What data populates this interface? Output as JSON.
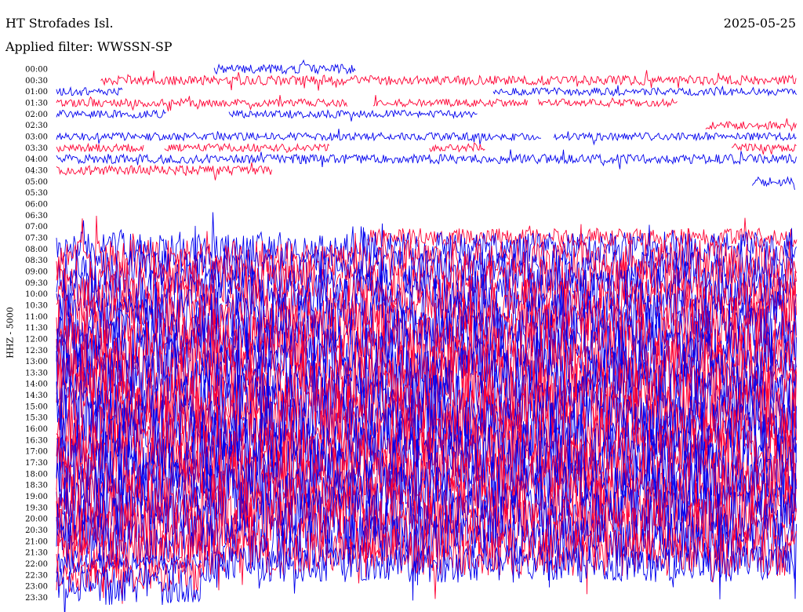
{
  "header": {
    "station": "HT Strofades Isl.",
    "date": "2025-05-25",
    "filter": "Applied filter: WWSSN-SP"
  },
  "chart_data": {
    "type": "line",
    "title": "HT Strofades Isl.",
    "subtitle": "Applied filter: WWSSN-SP",
    "ylabel": "HHZ - 5000",
    "xlabel": "",
    "tick_labels": [
      "00:00",
      "00:30",
      "01:00",
      "01:30",
      "02:00",
      "02:30",
      "03:00",
      "03:30",
      "04:00",
      "04:30",
      "05:00",
      "05:30",
      "06:00",
      "06:30",
      "07:00",
      "07:30",
      "08:00",
      "08:30",
      "09:00",
      "09:30",
      "10:00",
      "10:30",
      "11:00",
      "11:30",
      "12:00",
      "12:30",
      "13:00",
      "13:30",
      "14:00",
      "14:30",
      "15:00",
      "15:30",
      "16:00",
      "16:30",
      "17:00",
      "17:30",
      "18:00",
      "18:30",
      "19:00",
      "19:30",
      "20:00",
      "20:30",
      "21:00",
      "21:30",
      "22:00",
      "22:30",
      "23:00",
      "23:30"
    ],
    "x_minutes_per_line": 30,
    "colors": {
      "odd_lines": "#0000ee",
      "even_lines": "#ff0033"
    },
    "segments": [
      {
        "line": 0,
        "start": 0.213,
        "end": 0.405,
        "amp": 6
      },
      {
        "line": 1,
        "start": 0.06,
        "end": 1.0,
        "amp": 6
      },
      {
        "line": 2,
        "start": 0.0,
        "end": 0.089,
        "amp": 5
      },
      {
        "line": 2,
        "start": 0.59,
        "end": 1.0,
        "amp": 5
      },
      {
        "line": 3,
        "start": 0.0,
        "end": 0.393,
        "amp": 5
      },
      {
        "line": 3,
        "start": 0.428,
        "end": 0.637,
        "amp": 5
      },
      {
        "line": 3,
        "start": 0.651,
        "end": 0.839,
        "amp": 5
      },
      {
        "line": 4,
        "start": 0.0,
        "end": 0.149,
        "amp": 5
      },
      {
        "line": 4,
        "start": 0.233,
        "end": 0.569,
        "amp": 5
      },
      {
        "line": 5,
        "start": 0.877,
        "end": 1.0,
        "amp": 5
      },
      {
        "line": 6,
        "start": 0.0,
        "end": 0.656,
        "amp": 5
      },
      {
        "line": 6,
        "start": 0.672,
        "end": 1.0,
        "amp": 5
      },
      {
        "line": 7,
        "start": 0.0,
        "end": 0.119,
        "amp": 5
      },
      {
        "line": 7,
        "start": 0.146,
        "end": 0.369,
        "amp": 5
      },
      {
        "line": 7,
        "start": 0.504,
        "end": 0.58,
        "amp": 5
      },
      {
        "line": 7,
        "start": 0.912,
        "end": 1.0,
        "amp": 5
      },
      {
        "line": 8,
        "start": 0.0,
        "end": 1.0,
        "amp": 6
      },
      {
        "line": 9,
        "start": 0.0,
        "end": 0.292,
        "amp": 6
      },
      {
        "line": 10,
        "start": 0.94,
        "end": 0.998,
        "amp": 6
      },
      {
        "line": 15,
        "start": 0.42,
        "end": 1.0,
        "amp": 12
      },
      {
        "line": 16,
        "start": 0.0,
        "end": 1.0,
        "amp": 22
      },
      {
        "line": 17,
        "start": 0.0,
        "end": 1.0,
        "amp": 26
      },
      {
        "line": 18,
        "start": 0.0,
        "end": 1.0,
        "amp": 28
      },
      {
        "line": 19,
        "start": 0.0,
        "end": 1.0,
        "amp": 30
      },
      {
        "line": 20,
        "start": 0.0,
        "end": 1.0,
        "amp": 32
      },
      {
        "line": 21,
        "start": 0.0,
        "end": 1.0,
        "amp": 34
      },
      {
        "line": 22,
        "start": 0.0,
        "end": 1.0,
        "amp": 36
      },
      {
        "line": 23,
        "start": 0.0,
        "end": 1.0,
        "amp": 38
      },
      {
        "line": 24,
        "start": 0.0,
        "end": 1.0,
        "amp": 40
      },
      {
        "line": 25,
        "start": 0.0,
        "end": 1.0,
        "amp": 42
      },
      {
        "line": 26,
        "start": 0.0,
        "end": 1.0,
        "amp": 42
      },
      {
        "line": 27,
        "start": 0.0,
        "end": 1.0,
        "amp": 44
      },
      {
        "line": 28,
        "start": 0.0,
        "end": 1.0,
        "amp": 44
      },
      {
        "line": 29,
        "start": 0.0,
        "end": 1.0,
        "amp": 44
      },
      {
        "line": 30,
        "start": 0.0,
        "end": 1.0,
        "amp": 44
      },
      {
        "line": 31,
        "start": 0.0,
        "end": 1.0,
        "amp": 44
      },
      {
        "line": 32,
        "start": 0.0,
        "end": 1.0,
        "amp": 44
      },
      {
        "line": 33,
        "start": 0.0,
        "end": 1.0,
        "amp": 44
      },
      {
        "line": 34,
        "start": 0.0,
        "end": 1.0,
        "amp": 44
      },
      {
        "line": 35,
        "start": 0.0,
        "end": 1.0,
        "amp": 44
      },
      {
        "line": 36,
        "start": 0.0,
        "end": 1.0,
        "amp": 44
      },
      {
        "line": 37,
        "start": 0.0,
        "end": 1.0,
        "amp": 44
      },
      {
        "line": 38,
        "start": 0.0,
        "end": 1.0,
        "amp": 44
      },
      {
        "line": 39,
        "start": 0.0,
        "end": 1.0,
        "amp": 44
      },
      {
        "line": 40,
        "start": 0.0,
        "end": 1.0,
        "amp": 42
      },
      {
        "line": 41,
        "start": 0.0,
        "end": 1.0,
        "amp": 40
      },
      {
        "line": 42,
        "start": 0.0,
        "end": 1.0,
        "amp": 36
      },
      {
        "line": 43,
        "start": 0.0,
        "end": 1.0,
        "amp": 30
      },
      {
        "line": 44,
        "start": 0.0,
        "end": 0.196,
        "amp": 14
      },
      {
        "line": 44,
        "start": 0.196,
        "end": 1.0,
        "amp": 24
      },
      {
        "line": 45,
        "start": 0.0,
        "end": 0.196,
        "amp": 22
      },
      {
        "line": 46,
        "start": 0.0,
        "end": 0.196,
        "amp": 24
      }
    ]
  }
}
